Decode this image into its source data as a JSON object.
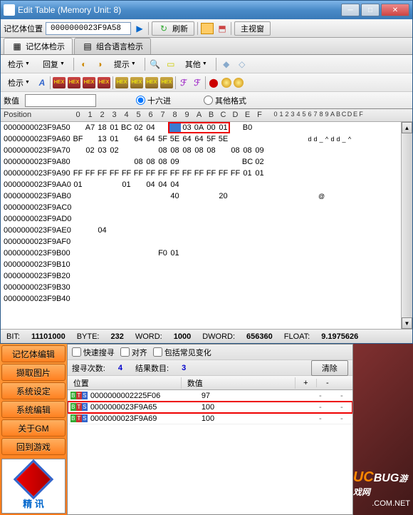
{
  "window": {
    "title": "Edit Table (Memory Unit: 8)"
  },
  "toolbar1": {
    "mem_loc_label": "记忆体位置",
    "address": "0000000023F9A58",
    "refresh": "刷新",
    "main_window": "主视窗"
  },
  "tabs": {
    "t1": "记忆体检示",
    "t2": "组合语言检示"
  },
  "toolbar2": {
    "b1": "检示",
    "b2": "回复",
    "b3": "提示",
    "b4": "其他"
  },
  "toolbar3": {
    "b1": "检示"
  },
  "valrow": {
    "label": "数值",
    "hex": "十六进",
    "other": "其他格式"
  },
  "hexheader": {
    "pos": "Position",
    "cols": [
      "0",
      "1",
      "2",
      "3",
      "4",
      "5",
      "6",
      "7",
      "8",
      "9",
      "A",
      "B",
      "C",
      "D",
      "E",
      "F"
    ],
    "asc": [
      "0",
      "1",
      "2",
      "3",
      "4",
      "5",
      "6",
      "7",
      "8",
      "9",
      "A",
      "B",
      "C",
      "D",
      "E",
      "F"
    ]
  },
  "rows": [
    {
      "addr": "0000000023F9A50",
      "b": [
        "",
        "A7",
        "18",
        "01",
        "BC",
        "02",
        "04",
        "",
        "",
        "03",
        "0A",
        "00",
        "01",
        "",
        "B0",
        ""
      ],
      "a": [
        "",
        "",
        "",
        "",
        "",
        "",
        "",
        "",
        "",
        "",
        "",
        "",
        "",
        "",
        "",
        ""
      ]
    },
    {
      "addr": "0000000023F9A60",
      "b": [
        "BF",
        "",
        "13",
        "01",
        "",
        "64",
        "64",
        "5F",
        "5E",
        "64",
        "64",
        "5F",
        "5E",
        "",
        "",
        ""
      ],
      "a": [
        "",
        "",
        "",
        "",
        "",
        "",
        "d",
        "d",
        "_",
        "^",
        "d",
        "d",
        "_",
        "^",
        "",
        ""
      ]
    },
    {
      "addr": "0000000023F9A70",
      "b": [
        "",
        "02",
        "03",
        "02",
        "",
        "",
        "",
        "08",
        "08",
        "08",
        "08",
        "08",
        "",
        "08",
        "08",
        "09"
      ],
      "a": [
        "",
        "",
        "",
        "",
        "",
        "",
        "",
        "",
        "",
        "",
        "",
        "",
        "",
        "",
        "",
        ""
      ]
    },
    {
      "addr": "0000000023F9A80",
      "b": [
        "",
        "",
        "",
        "",
        "",
        "08",
        "08",
        "08",
        "09",
        "",
        "",
        "",
        "",
        "",
        "BC",
        "02"
      ],
      "a": [
        "",
        "",
        "",
        "",
        "",
        "",
        "",
        "",
        "",
        "",
        "",
        "",
        "",
        "",
        "",
        ""
      ]
    },
    {
      "addr": "0000000023F9A90",
      "b": [
        "FF",
        "FF",
        "FF",
        "FF",
        "FF",
        "FF",
        "FF",
        "FF",
        "FF",
        "FF",
        "FF",
        "FF",
        "FF",
        "FF",
        "01",
        "01"
      ],
      "a": [
        "",
        "",
        "",
        "",
        "",
        "",
        "",
        "",
        "",
        "",
        "",
        "",
        "",
        "",
        "",
        ""
      ]
    },
    {
      "addr": "0000000023F9AA0",
      "b": [
        "01",
        "",
        "",
        "",
        "01",
        "",
        "04",
        "04",
        "04",
        "",
        "",
        "",
        "",
        "",
        "",
        ""
      ],
      "a": [
        "",
        "",
        "",
        "",
        "",
        "",
        "",
        "",
        "",
        "",
        "",
        "",
        "",
        "",
        "",
        ""
      ]
    },
    {
      "addr": "0000000023F9AB0",
      "b": [
        "",
        "",
        "",
        "",
        "",
        "",
        "",
        "",
        "40",
        "",
        "",
        "",
        "20",
        "",
        "",
        ""
      ],
      "a": [
        "",
        "",
        "",
        "",
        "",
        "",
        "",
        "",
        "@",
        "",
        "",
        "",
        "",
        "",
        "",
        ""
      ]
    },
    {
      "addr": "0000000023F9AC0",
      "b": [
        "",
        "",
        "",
        "",
        "",
        "",
        "",
        "",
        "",
        "",
        "",
        "",
        "",
        "",
        "",
        ""
      ],
      "a": [
        "",
        "",
        "",
        "",
        "",
        "",
        "",
        "",
        "",
        "",
        "",
        "",
        "",
        "",
        "",
        ""
      ]
    },
    {
      "addr": "0000000023F9AD0",
      "b": [
        "",
        "",
        "",
        "",
        "",
        "",
        "",
        "",
        "",
        "",
        "",
        "",
        "",
        "",
        "",
        ""
      ],
      "a": [
        "",
        "",
        "",
        "",
        "",
        "",
        "",
        "",
        "",
        "",
        "",
        "",
        "",
        "",
        "",
        ""
      ]
    },
    {
      "addr": "0000000023F9AE0",
      "b": [
        "",
        "",
        "04",
        "",
        "",
        "",
        "",
        "",
        "",
        "",
        "",
        "",
        "",
        "",
        "",
        ""
      ],
      "a": [
        "",
        "",
        "",
        "",
        "",
        "",
        "",
        "",
        "",
        "",
        "",
        "",
        "",
        "",
        "",
        ""
      ]
    },
    {
      "addr": "0000000023F9AF0",
      "b": [
        "",
        "",
        "",
        "",
        "",
        "",
        "",
        "",
        "",
        "",
        "",
        "",
        "",
        "",
        "",
        ""
      ],
      "a": [
        "",
        "",
        "",
        "",
        "",
        "",
        "",
        "",
        "",
        "",
        "",
        "",
        "",
        "",
        "",
        ""
      ]
    },
    {
      "addr": "0000000023F9B00",
      "b": [
        "",
        "",
        "",
        "",
        "",
        "",
        "",
        "F0",
        "01",
        "",
        "",
        "",
        "",
        "",
        "",
        ""
      ],
      "a": [
        "",
        "",
        "",
        "",
        "",
        "",
        "",
        "",
        "",
        "",
        "",
        "",
        "",
        "",
        "",
        ""
      ]
    },
    {
      "addr": "0000000023F9B10",
      "b": [
        "",
        "",
        "",
        "",
        "",
        "",
        "",
        "",
        "",
        "",
        "",
        "",
        "",
        "",
        "",
        ""
      ],
      "a": [
        "",
        "",
        "",
        "",
        "",
        "",
        "",
        "",
        "",
        "",
        "",
        "",
        "",
        "",
        "",
        ""
      ]
    },
    {
      "addr": "0000000023F9B20",
      "b": [
        "",
        "",
        "",
        "",
        "",
        "",
        "",
        "",
        "",
        "",
        "",
        "",
        "",
        "",
        "",
        ""
      ],
      "a": [
        "",
        "",
        "",
        "",
        "",
        "",
        "",
        "",
        "",
        "",
        "",
        "",
        "",
        "",
        "",
        ""
      ]
    },
    {
      "addr": "0000000023F9B30",
      "b": [
        "",
        "",
        "",
        "",
        "",
        "",
        "",
        "",
        "",
        "",
        "",
        "",
        "",
        "",
        "",
        ""
      ],
      "a": [
        "",
        "",
        "",
        "",
        "",
        "",
        "",
        "",
        "",
        "",
        "",
        "",
        "",
        "",
        "",
        ""
      ]
    },
    {
      "addr": "0000000023F9B40",
      "b": [
        "",
        "",
        "",
        "",
        "",
        "",
        "",
        "",
        "",
        "",
        "",
        "",
        "",
        "",
        "",
        ""
      ],
      "a": [
        "",
        "",
        "",
        "",
        "",
        "",
        "",
        "",
        "",
        "",
        "",
        "",
        "",
        "",
        "",
        ""
      ]
    }
  ],
  "status": {
    "bit_l": "BIT:",
    "bit_v": "11101000",
    "byte_l": "BYTE:",
    "byte_v": "232",
    "word_l": "WORD:",
    "word_v": "1000",
    "dword_l": "DWORD:",
    "dword_v": "656360",
    "float_l": "FLOAT:",
    "float_v": "9.1975626"
  },
  "sidebar": {
    "b1": "记忆体编辑",
    "b2": "撷取图片",
    "b3": "系统设定",
    "b4": "系统编辑",
    "b5": "关于GM",
    "b6": "回到游戏",
    "logo": "精 讯"
  },
  "search": {
    "fast": "快速搜寻",
    "align": "对齐",
    "include": "包括常见变化",
    "count_l": "搜寻次数:",
    "count_v": "4",
    "results_l": "结果数目:",
    "results_v": "3",
    "clear": "清除",
    "hdr_pos": "位置",
    "hdr_val": "数值",
    "hdr_p": "+",
    "hdr_m": "-",
    "rows": [
      {
        "addr": "0000000002225F06",
        "val": "97",
        "p": "-",
        "m": "-"
      },
      {
        "addr": "0000000023F9A65",
        "val": "100",
        "p": "-",
        "m": "-"
      },
      {
        "addr": "0000000023F9A69",
        "val": "100",
        "p": "-",
        "m": "-"
      }
    ]
  },
  "wm": {
    "u": "UC",
    "c": "BUG",
    "t": "游戏网",
    "d": ".COM.NET"
  }
}
